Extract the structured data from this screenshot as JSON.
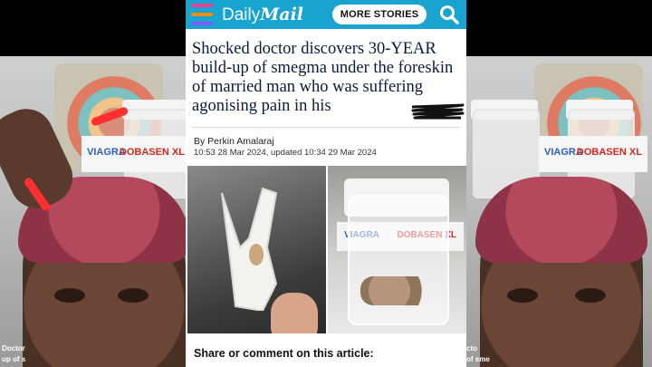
{
  "header": {
    "brand_daily": "Daily",
    "brand_mail": "Mail",
    "more_stories_label": "MORE STORIES",
    "menu_colors": [
      "#e8428c",
      "#ff8a00",
      "#7a5cff"
    ]
  },
  "article": {
    "headline": "Shocked doctor discovers 30-YEAR build-up of smegma under the foreskin of married man who was suffering agonising pain in his",
    "byline": "By Perkin Amalaraj",
    "dates": "10:53 28 Mar 2024, updated 10:34 29 Mar 2024",
    "share_label": "Share or comment on this article:"
  },
  "images": {
    "box_brand_left": "VIAGRA",
    "box_brand_right": "DOBASEN XL"
  },
  "side_video": {
    "caption_left_1": "Doctor",
    "caption_left_2": "up of s",
    "caption_right_1": "cto",
    "caption_right_2": "of sme"
  },
  "colors": {
    "header_bg": "#18a3d0",
    "headline_text": "#0b1c3a",
    "nail_red": "#ff3030"
  }
}
